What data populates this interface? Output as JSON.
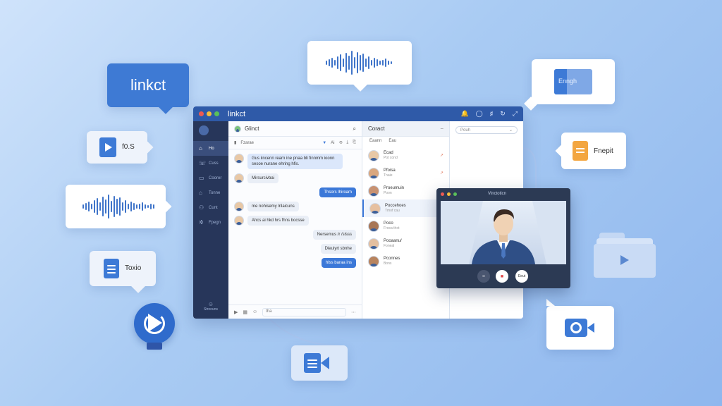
{
  "floating": {
    "logo_bubble": "linkct",
    "video_file": "f0.S",
    "doc_file_left": "Toxio",
    "doc_file_right": "Fnepit",
    "image_file": "Enngh"
  },
  "window": {
    "title": "linkct",
    "sidebar": [
      {
        "icon": "⌂",
        "label": "Ho"
      },
      {
        "icon": "☏",
        "label": "Cuss"
      },
      {
        "icon": "▭",
        "label": "Coorer"
      },
      {
        "icon": "⌂",
        "label": "Tonne"
      },
      {
        "icon": "⚇",
        "label": "Cunt"
      },
      {
        "icon": "✲",
        "label": "Fpegn"
      }
    ],
    "sidebar_bottom": "Stroouns",
    "chat": {
      "title": "Glinct",
      "subtitle": "Fzarae",
      "messages": [
        {
          "side": "left",
          "style": "blue",
          "text": "Gus iincenn  rearn  ine pnaa bli  finnmm ioonn sesoe nurane  ehring hfis."
        },
        {
          "side": "left",
          "style": "",
          "text": "Mirsurcivbai"
        },
        {
          "side": "right",
          "style": "solid",
          "text": "Thsors lhiroam"
        },
        {
          "side": "left",
          "style": "",
          "text": "me nohisemy lrilaicuns"
        },
        {
          "side": "left",
          "style": "",
          "text": "Ahcs ai hkd hrs fhns bocsse"
        },
        {
          "side": "right",
          "style": "",
          "text": "Nersemus /r /slsss"
        },
        {
          "side": "right",
          "style": "",
          "text": "Dieuiyrt sbnhe"
        },
        {
          "side": "right",
          "style": "solid",
          "text": "hlss baraa ins"
        }
      ],
      "input_placeholder": "tha"
    },
    "contacts": {
      "title": "Coract",
      "tabs": [
        "Eaann",
        "Eau"
      ],
      "items": [
        {
          "name": "Ecad",
          "sub": "Pot cond"
        },
        {
          "name": "Pfoisa",
          "sub": "Tnaie"
        },
        {
          "name": "Proeumuin",
          "sub": "Poon"
        },
        {
          "name": "Poccehoes",
          "sub": "Tmof cau"
        },
        {
          "name": "Poco",
          "sub": "Froca thot"
        },
        {
          "name": "Pooaanu/",
          "sub": "Foneal"
        },
        {
          "name": "Pconnes",
          "sub": "Bons"
        }
      ]
    },
    "search_placeholder": "Pouh"
  },
  "video_call": {
    "title": "Vinctoticn",
    "buttons": [
      "∞",
      "■",
      "Eeut"
    ]
  },
  "colors": {
    "accent": "#3b78d8",
    "sidebar": "#27365a",
    "titlebar": "#2f5aa8"
  }
}
